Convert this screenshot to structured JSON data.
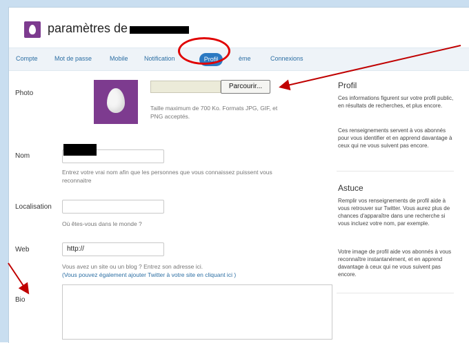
{
  "header": {
    "title": "paramètres de "
  },
  "tabs": [
    {
      "label": "Compte"
    },
    {
      "label": "Mot de passe"
    },
    {
      "label": "Mobile"
    },
    {
      "label": "Notification"
    },
    {
      "label": "Profil"
    },
    {
      "label": "ème"
    },
    {
      "label": "Connexions"
    }
  ],
  "form": {
    "photo_label": "Photo",
    "browse_label": "Parcourir...",
    "photo_help_1": "Taille maximum de 700 Ko. Formats JPG, GIF, et",
    "photo_help_2": "PNG acceptés.",
    "name_label": "Nom",
    "name_help_1": "Entrez votre vrai nom afin que les personnes que vous connaissez puissent vous",
    "name_help_2": "reconnaitre",
    "location_label": "Localisation",
    "location_help": "Où êtes-vous dans le monde ?",
    "web_label": "Web",
    "web_value": "http://",
    "web_help": "Vous avez un site ou un blog ? Entrez son adresse ici.",
    "web_link": "(Vous pouvez également ajouter Twitter à votre site en cliquant ici )",
    "bio_label": "Bio"
  },
  "sidebar": {
    "profil_title": "Profil",
    "profil_text_1": "Ces informations figurent sur votre profil public, en résultats de recherches, et plus encore.",
    "profil_text_2": "Ces renseignements servent à vos abonnés pour vous identifier et en apprend davantage à ceux qui ne vous suivent pas encore.",
    "astuce_title": "Astuce",
    "astuce_text_1": "Remplir vos renseignements de profil aide à vous retrouver sur Twitter. Vous aurez plus de chances d'apparaître dans une recherche si vous incluez votre nom, par exemple.",
    "astuce_text_2": "Votre image de profil aide vos abonnés à vous reconnaître instantanément, et en apprend davantage à ceux qui ne vous suivent pas encore."
  },
  "colors": {
    "accent": "#2b79c2",
    "annotation": "#e00000",
    "avatar": "#7d3b8f"
  }
}
